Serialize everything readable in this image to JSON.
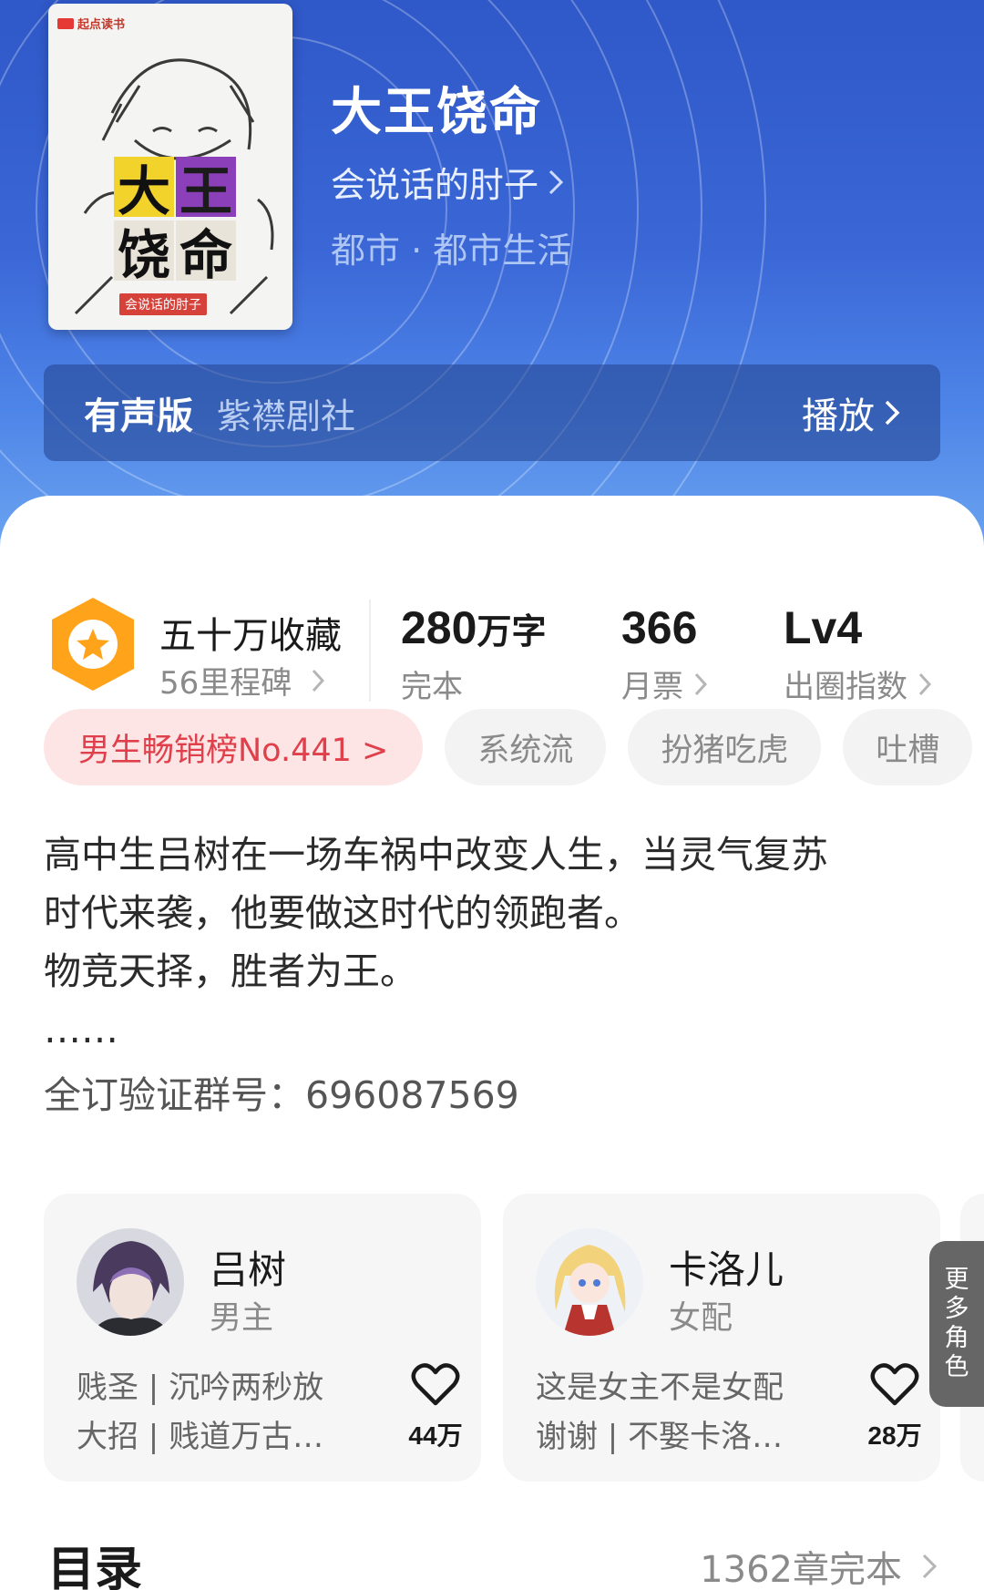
{
  "book": {
    "title": "大王饶命",
    "author": "会说话的肘子",
    "genre": "都市 · 都市生活",
    "cover": {
      "brand": "起点读书",
      "title_chars": [
        "大",
        "王",
        "饶",
        "命"
      ],
      "author_tag": "会说话的肘子"
    }
  },
  "audio": {
    "label": "有声版",
    "studio": "紫襟剧社",
    "play_label": "播放"
  },
  "stats": {
    "collect_title": "五十万收藏",
    "collect_sub": "56里程碑",
    "words_value": "280",
    "words_unit": "万字",
    "words_label": "完本",
    "monthly_value": "366",
    "monthly_label": "月票",
    "level_value": "Lv4",
    "level_label": "出圈指数"
  },
  "tags": {
    "rank": "男生畅销榜No.441 >",
    "items": [
      "系统流",
      "扮猪吃虎",
      "吐槽"
    ]
  },
  "synopsis": {
    "lines": [
      "高中生吕树在一场车祸中改变人生，当灵气复苏",
      "时代来袭，他要做这时代的领跑者。",
      "物竞天择，胜者为王。",
      "……"
    ],
    "group": "全订验证群号：696087569"
  },
  "roles": [
    {
      "name": "吕树",
      "type": "男主",
      "desc": [
        "贱圣 | 沉吟两秒放",
        "大招 | 贱道万古…"
      ],
      "likes": "44万"
    },
    {
      "name": "卡洛儿",
      "type": "女配",
      "desc": [
        "这是女主不是女配",
        "谢谢 | 不娶卡洛…"
      ],
      "likes": "28万"
    }
  ],
  "more_roles": [
    "更",
    "多",
    "角",
    "色"
  ],
  "toc": {
    "title": "目录",
    "summary": "1362章完本"
  },
  "colors": {
    "hero_blue": "#3a66d6",
    "rank_red": "#e0404b",
    "badge_orange": "#ffa31a"
  }
}
